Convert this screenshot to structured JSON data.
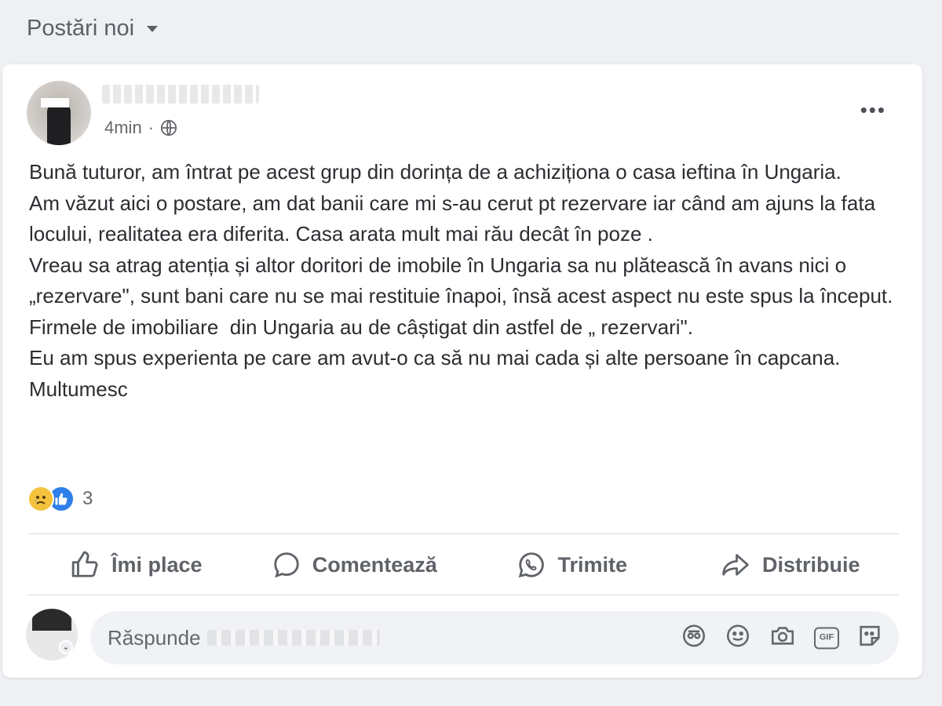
{
  "feed": {
    "sort_label": "Postări noi"
  },
  "post": {
    "timestamp": "4min",
    "visibility_icon": "globe-icon",
    "paragraphs": [
      "Bună tuturor, am întrat pe acest grup din dorința de a achiziționa o casa ieftina în Ungaria.",
      "Am văzut aici o postare, am dat banii care mi s-au cerut pt rezervare iar când am ajuns la fata locului, realitatea era diferita. Casa arata mult mai rău decât în poze .",
      "Vreau sa atrag atenția și altor doritori de imobile în Ungaria sa nu plătească în avans nici o „rezervare\", sunt bani care nu se mai restituie înapoi, însă acest aspect nu este spus la început. Firmele de imobiliare  din Ungaria au de câștigat din astfel de „ rezervari\".",
      "Eu am spus experienta pe care am avut-o ca să nu mai cada și alte persoane în capcana. Multumesc"
    ],
    "reactions": {
      "types": [
        "sad-reaction-icon",
        "like-reaction-icon"
      ],
      "count": "3"
    }
  },
  "actions": {
    "like": "Îmi place",
    "comment": "Comentează",
    "send": "Trimite",
    "share": "Distribuie"
  },
  "reply": {
    "placeholder": "Răspunde"
  },
  "colors": {
    "page_bg": "#eef0f3",
    "card_bg": "#ffffff",
    "secondary_text": "#65676b",
    "like_blue": "#2f7fe8",
    "sad_yellow": "#f4c23c"
  }
}
